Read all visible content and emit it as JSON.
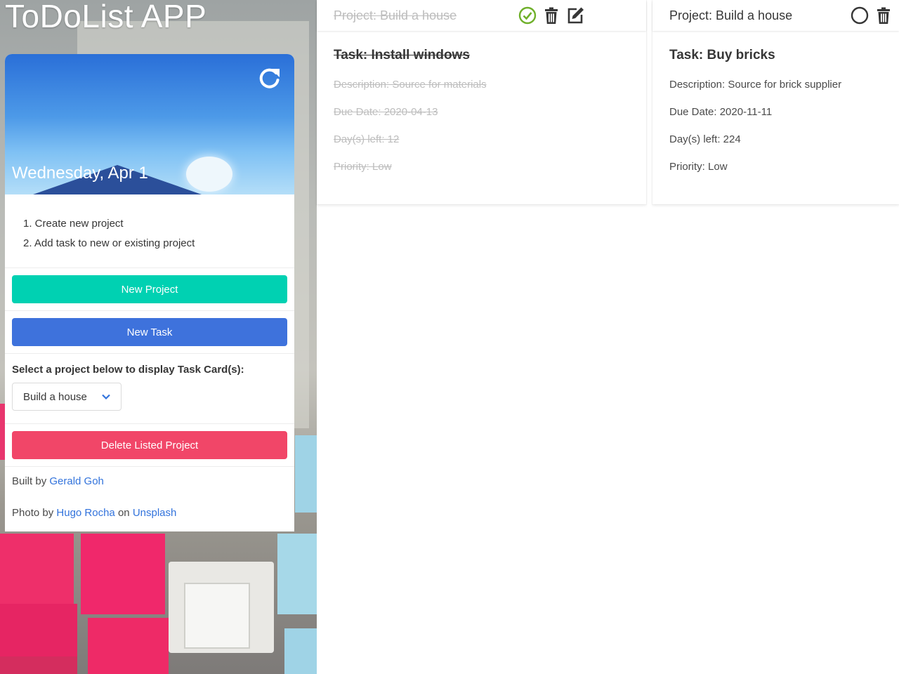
{
  "app": {
    "title": "ToDoList APP"
  },
  "sidebar": {
    "date": "Wednesday, Apr 1",
    "steps": [
      "1. Create new project",
      "2. Add task to new or existing project"
    ],
    "new_project_label": "New Project",
    "new_task_label": "New Task",
    "select_label": "Select a project below to display Task Card(s):",
    "selected_project": "Build a house",
    "delete_label": "Delete Listed Project",
    "credits": {
      "built_by_prefix": "Built by ",
      "author": "Gerald Goh",
      "photo_prefix": "Photo by ",
      "photographer": "Hugo Rocha",
      "on": " on ",
      "source": "Unsplash"
    }
  },
  "cards": [
    {
      "project": "Project: Build a house",
      "task": "Task: Install windows",
      "description": "Description: Source for materials",
      "due": "Due Date: 2020-04-13",
      "days_left": "Day(s) left: 12",
      "priority": "Priority: Low",
      "status": "completed",
      "icons": [
        "check-circle-icon",
        "trash-icon",
        "edit-icon"
      ]
    },
    {
      "project": "Project: Build a house",
      "task": "Task: Buy bricks",
      "description": "Description: Source for brick supplier",
      "due": "Due Date: 2020-11-11",
      "days_left": "Day(s) left: 224",
      "priority": "Priority: Low",
      "status": "pending",
      "icons": [
        "empty-circle-icon",
        "trash-icon"
      ]
    }
  ],
  "colors": {
    "teal": "#00d1b2",
    "blue": "#3e72dc",
    "red": "#f14668",
    "link": "#3273dc",
    "check_green": "#6fb02a"
  }
}
